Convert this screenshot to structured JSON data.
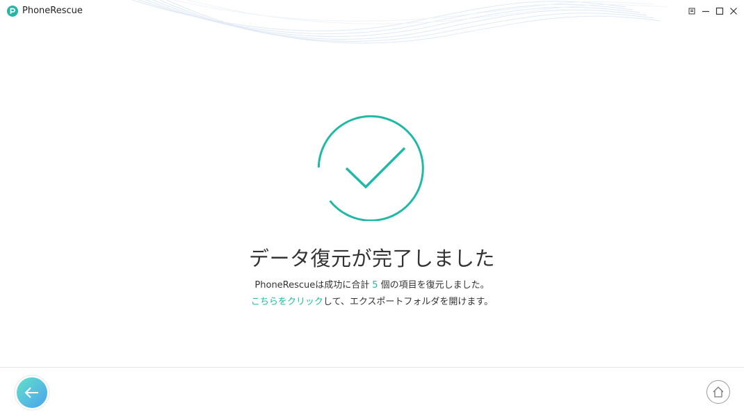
{
  "app": {
    "title": "PhoneRescue"
  },
  "window_controls": {
    "menu_icon": "menu-icon",
    "minimize_icon": "minimize-icon",
    "maximize_icon": "maximize-icon",
    "close_icon": "close-icon"
  },
  "main": {
    "status_icon": "checkmark-circle-icon",
    "title": "データ復元が完了しました",
    "summary_prefix": "PhoneRescueは成功に合計",
    "summary_count": "5",
    "summary_suffix": "個の項目を復元しました。",
    "link_text": "こちらをクリック",
    "link_suffix": "して、エクスポートフォルダを開けます。"
  },
  "footer": {
    "back_icon": "back-arrow-icon",
    "home_icon": "home-icon"
  },
  "colors": {
    "accent": "#1fb9a5",
    "back_gradient_start": "#63e0c9",
    "back_gradient_end": "#4aa3ee",
    "text": "#333333"
  }
}
